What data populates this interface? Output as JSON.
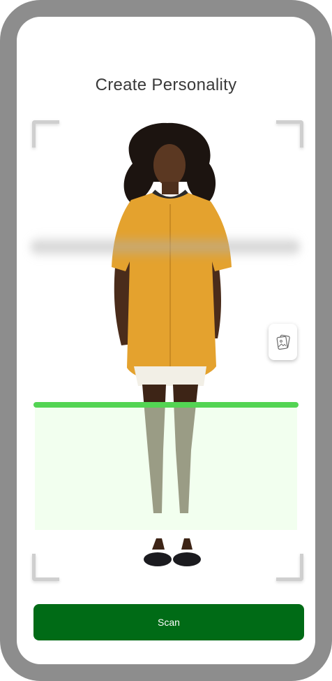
{
  "screen": {
    "title": "Create Personality"
  },
  "viewfinder": {
    "gallery_icon": "photo-gallery-icon",
    "scan_line_color": "#53d453",
    "scan_area_color": "#e8ffe2"
  },
  "actions": {
    "scan_label": "Scan",
    "scan_color": "#006b16"
  }
}
